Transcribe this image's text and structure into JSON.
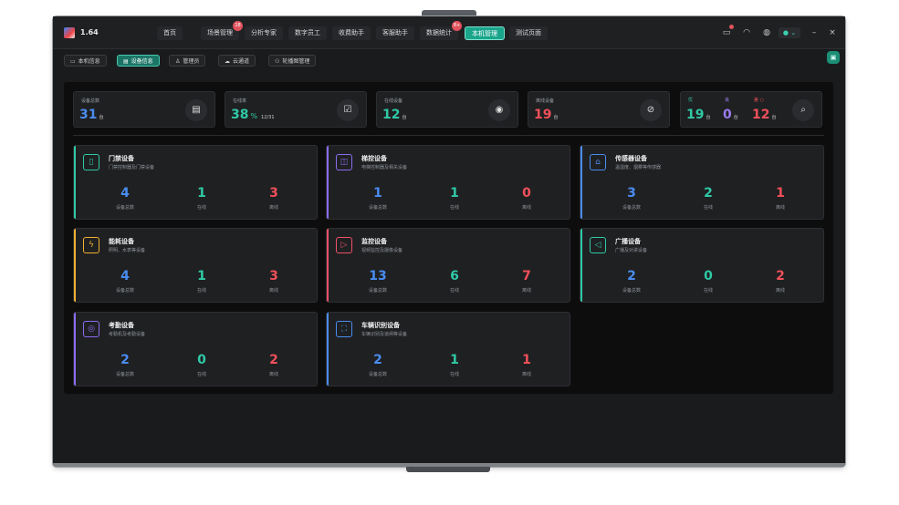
{
  "app": {
    "version": "1.64"
  },
  "nav": [
    {
      "label": "首页"
    },
    {
      "label": "场景管理",
      "badge": "18"
    },
    {
      "label": "分析专家"
    },
    {
      "label": "数字员工"
    },
    {
      "label": "收费助手"
    },
    {
      "label": "客服助手"
    },
    {
      "label": "数据统计",
      "badge": "8+"
    },
    {
      "label": "本机管理",
      "active": true
    },
    {
      "label": "测试页面"
    }
  ],
  "topright": {
    "message_badge": "1",
    "user_chevron": "⌄",
    "minimize": "–",
    "close": "×"
  },
  "subtabs": [
    {
      "label": "本机信息",
      "icon": "monitor-icon"
    },
    {
      "label": "设备信息",
      "icon": "device-icon",
      "active": true
    },
    {
      "label": "管理员",
      "icon": "user-icon"
    },
    {
      "label": "云通道",
      "icon": "cloud-icon"
    },
    {
      "label": "轮播图管理",
      "icon": "carousel-icon"
    }
  ],
  "stats": [
    {
      "label": "设备总数",
      "value": "31",
      "unit": "台",
      "color": "#4a8cf0"
    },
    {
      "label": "在线率",
      "value": "38",
      "unit": "%",
      "extra": "12/31",
      "color": "#2fc9a6"
    },
    {
      "label": "在线设备",
      "value": "12",
      "unit": "台",
      "color": "#2fc9a6"
    },
    {
      "label": "离线设备",
      "value": "19",
      "unit": "台",
      "color": "#f0505a"
    },
    {
      "mini": [
        {
          "label": "优",
          "value": "19",
          "unit": "台",
          "color": "#2fc9a6"
        },
        {
          "label": "良",
          "value": "0",
          "unit": "台",
          "color": "#9a7cf0"
        },
        {
          "label": "差",
          "value": "12",
          "unit": "台",
          "color": "#f0505a"
        }
      ]
    }
  ],
  "colors": {
    "total": "#4a8cf0",
    "online": "#2fc9a6",
    "offline": "#f0505a"
  },
  "labels": {
    "total": "设备总数",
    "online": "在线",
    "offline": "离线"
  },
  "cards": [
    {
      "title": "门禁设备",
      "subtitle": "门禁控制器及门禁设备",
      "total": "4",
      "online": "1",
      "offline": "3",
      "accent": "#2fc9a6",
      "icon": "door-icon"
    },
    {
      "title": "梯控设备",
      "subtitle": "电梯控制器及相关设备",
      "total": "1",
      "online": "1",
      "offline": "0",
      "accent": "#8a6cf0",
      "icon": "elevator-icon"
    },
    {
      "title": "传感器设备",
      "subtitle": "温湿度、烟雾等传感器",
      "total": "3",
      "online": "2",
      "offline": "1",
      "accent": "#4a8cf0",
      "icon": "sensor-icon"
    },
    {
      "title": "能耗设备",
      "subtitle": "照明、水表等设备",
      "total": "4",
      "online": "1",
      "offline": "3",
      "accent": "#f0b030",
      "icon": "energy-icon"
    },
    {
      "title": "监控设备",
      "subtitle": "视频监控及摄像设备",
      "total": "13",
      "online": "6",
      "offline": "7",
      "accent": "#f05068",
      "icon": "camera-icon"
    },
    {
      "title": "广播设备",
      "subtitle": "广播及对讲设备",
      "total": "2",
      "online": "0",
      "offline": "2",
      "accent": "#2fc9a6",
      "icon": "speaker-icon"
    },
    {
      "title": "考勤设备",
      "subtitle": "考勤机及考勤设备",
      "total": "2",
      "online": "0",
      "offline": "2",
      "accent": "#8a6cf0",
      "icon": "fingerprint-icon"
    },
    {
      "title": "车辆识别设备",
      "subtitle": "车辆识别及道闸等设备",
      "total": "2",
      "online": "1",
      "offline": "1",
      "accent": "#4a8cf0",
      "icon": "vehicle-scan-icon"
    }
  ]
}
